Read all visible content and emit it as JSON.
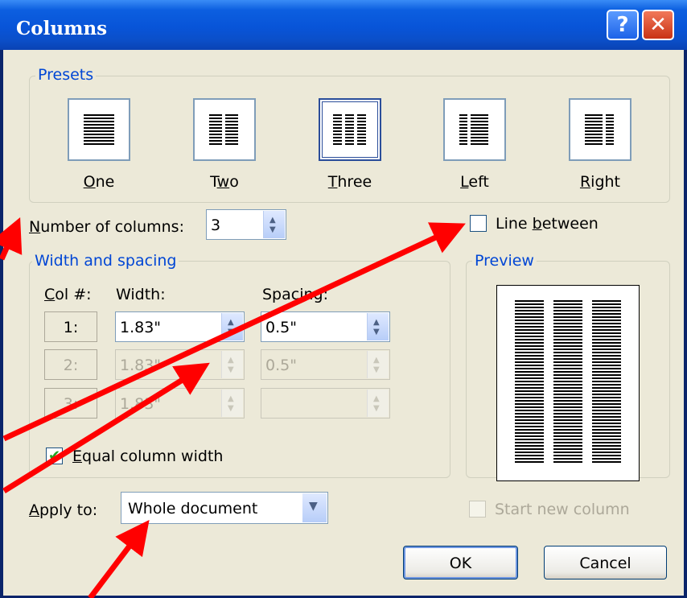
{
  "dialog": {
    "title": "Columns",
    "help_glyph": "?",
    "close_glyph": "✕"
  },
  "presets": {
    "legend": "Presets",
    "items": [
      {
        "key": "O",
        "rest": "ne"
      },
      {
        "key": "",
        "pre": "T",
        "k2": "w",
        "rest": "o"
      },
      {
        "key": "T",
        "rest": "hree"
      },
      {
        "key": "L",
        "rest": "eft"
      },
      {
        "key": "R",
        "rest": "ight"
      }
    ],
    "selected": "Three"
  },
  "number_of_columns": {
    "label_key": "N",
    "label_rest": "umber of columns:",
    "value": "3"
  },
  "line_between": {
    "label_pre": "Line ",
    "label_key": "b",
    "label_rest": "etween",
    "checked": false
  },
  "width_spacing": {
    "legend": "Width and spacing",
    "col_header_key": "C",
    "col_header_rest": "ol #:",
    "width_header": "Width:",
    "spacing_header": "Spacing:",
    "rows": [
      {
        "col": "1:",
        "width": "1.83\"",
        "spacing": "0.5\"",
        "enabled": true
      },
      {
        "col": "2:",
        "width": "1.83\"",
        "spacing": "0.5\"",
        "enabled": false
      },
      {
        "col": "3:",
        "width": "1.83\"",
        "spacing": "",
        "enabled": false
      }
    ]
  },
  "equal_width": {
    "label_key": "E",
    "label_rest": "qual column width",
    "checked": true
  },
  "preview": {
    "legend": "Preview"
  },
  "apply_to": {
    "label_key": "A",
    "label_rest": "pply to:",
    "value": "Whole document"
  },
  "start_new_column": {
    "label": "Start new column",
    "enabled": false
  },
  "buttons": {
    "ok": "OK",
    "cancel": "Cancel"
  },
  "colors": {
    "annotation_arrow": "#ff0000",
    "titlebar": "#0854d8"
  }
}
